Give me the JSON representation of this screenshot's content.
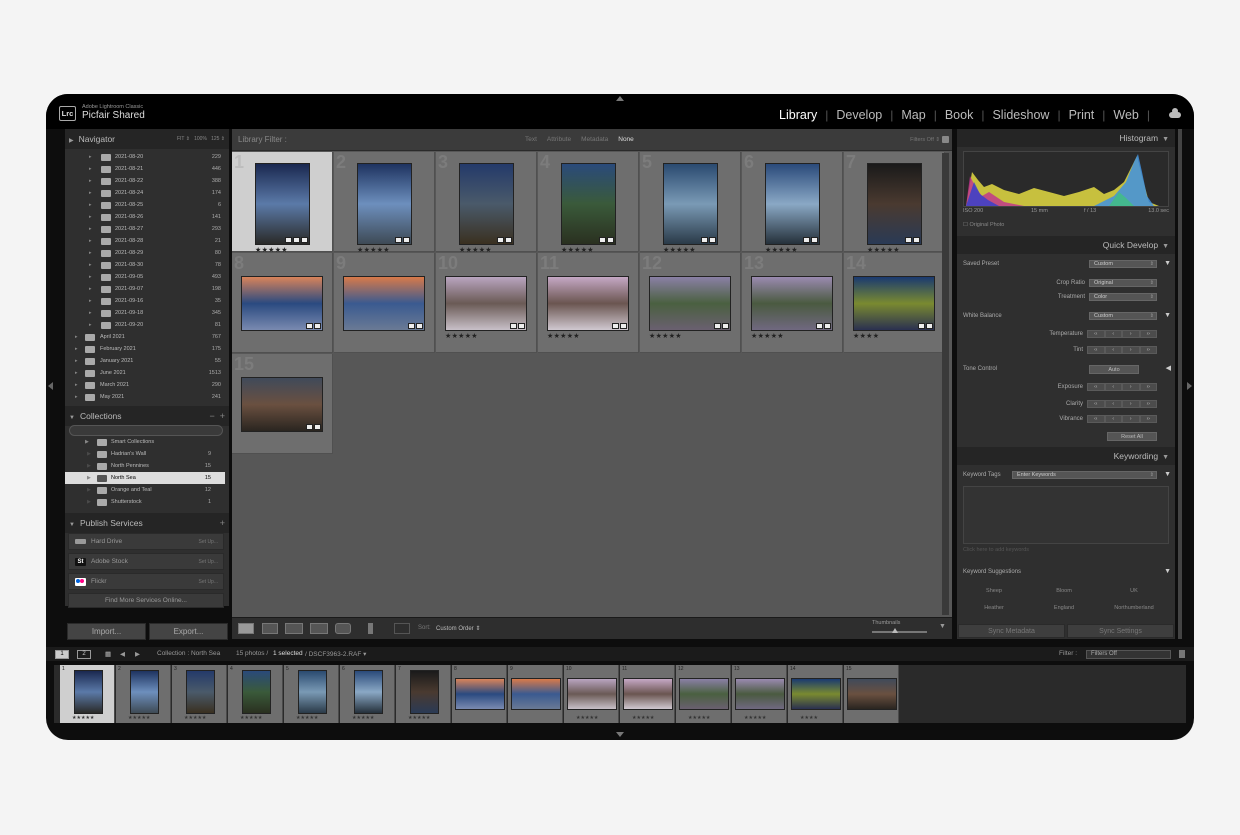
{
  "app": {
    "product": "Adobe Lightroom Classic",
    "catalog": "Picfair Shared",
    "logo": "Lrc",
    "modules": [
      "Library",
      "Develop",
      "Map",
      "Book",
      "Slideshow",
      "Print",
      "Web"
    ],
    "active_module": "Library"
  },
  "navigator": {
    "title": "Navigator",
    "zoom_options": [
      "FIT ⇕",
      "100%",
      "125 ⇕"
    ]
  },
  "folders": [
    {
      "name": "2021-08-20",
      "count": "229"
    },
    {
      "name": "2021-08-21",
      "count": "446"
    },
    {
      "name": "2021-08-22",
      "count": "388"
    },
    {
      "name": "2021-08-24",
      "count": "174"
    },
    {
      "name": "2021-08-25",
      "count": "6"
    },
    {
      "name": "2021-08-26",
      "count": "141"
    },
    {
      "name": "2021-08-27",
      "count": "293"
    },
    {
      "name": "2021-08-28",
      "count": "21"
    },
    {
      "name": "2021-08-29",
      "count": "80"
    },
    {
      "name": "2021-08-30",
      "count": "78"
    },
    {
      "name": "2021-09-05",
      "count": "493"
    },
    {
      "name": "2021-09-07",
      "count": "198"
    },
    {
      "name": "2021-09-16",
      "count": "35"
    },
    {
      "name": "2021-09-18",
      "count": "345"
    },
    {
      "name": "2021-09-20",
      "count": "81"
    },
    {
      "name": "April 2021",
      "count": "767"
    },
    {
      "name": "February 2021",
      "count": "175"
    },
    {
      "name": "January 2021",
      "count": "55"
    },
    {
      "name": "June 2021",
      "count": "1513"
    },
    {
      "name": "March 2021",
      "count": "290"
    },
    {
      "name": "May 2021",
      "count": "241"
    }
  ],
  "collections": {
    "title": "Collections",
    "items": [
      {
        "name": "Smart Collections",
        "count": ""
      },
      {
        "name": "Hadrian's Wall",
        "count": "9"
      },
      {
        "name": "North Pennines",
        "count": "15"
      },
      {
        "name": "North Sea",
        "count": "15"
      },
      {
        "name": "Orange and Teal",
        "count": "12"
      },
      {
        "name": "Shutterstock",
        "count": "1"
      }
    ]
  },
  "publish": {
    "title": "Publish Services",
    "services": [
      {
        "name": "Hard Drive",
        "setup": "Set Up..."
      },
      {
        "name": "Adobe Stock",
        "setup": "Set Up..."
      },
      {
        "name": "Flickr",
        "setup": "Set Up..."
      }
    ],
    "find_more": "Find More Services Online..."
  },
  "buttons": {
    "import": "Import...",
    "export": "Export..."
  },
  "library_filter": {
    "label": "Library Filter :",
    "tabs": [
      "Text",
      "Attribute",
      "Metadata",
      "None"
    ],
    "active": "None",
    "filters_off": "Filters Off ⇕"
  },
  "grid": {
    "cells": [
      {
        "num": "1",
        "stars": "★★★★★",
        "colors": [
          "#1a2850",
          "#5b7aa8",
          "#2a2a28"
        ]
      },
      {
        "num": "2",
        "stars": "★★★★★",
        "colors": [
          "#1e3360",
          "#6d8fbd",
          "#3e4a55"
        ]
      },
      {
        "num": "3",
        "stars": "★★★★★",
        "colors": [
          "#243a6a",
          "#4a5a6a",
          "#3a3020"
        ]
      },
      {
        "num": "4",
        "stars": "★★★★★",
        "colors": [
          "#2a4a7a",
          "#3a5a3a",
          "#2a3020"
        ]
      },
      {
        "num": "5",
        "stars": "★★★★★",
        "colors": [
          "#2a4a70",
          "#7a9ab5",
          "#2a3a48"
        ]
      },
      {
        "num": "6",
        "stars": "★★★★★",
        "colors": [
          "#2a4a7a",
          "#8aa8c5",
          "#25303a"
        ]
      },
      {
        "num": "7",
        "stars": "★★★★★",
        "colors": [
          "#1a1a1a",
          "#4a3a30",
          "#2a3a55"
        ]
      },
      {
        "num": "8",
        "stars": "",
        "colors": [
          "#d8835a",
          "#2a4a80",
          "#7a8ab0"
        ]
      },
      {
        "num": "9",
        "stars": "",
        "colors": [
          "#d87a4a",
          "#3a5a90",
          "#6a7a95"
        ]
      },
      {
        "num": "10",
        "stars": "★★★★★",
        "colors": [
          "#b9a5c0",
          "#6a5a55",
          "#c8c0c8"
        ]
      },
      {
        "num": "11",
        "stars": "★★★★★",
        "colors": [
          "#c5a8c5",
          "#6a5550",
          "#d0c8d0"
        ]
      },
      {
        "num": "12",
        "stars": "★★★★★",
        "colors": [
          "#8a80a5",
          "#4a6040",
          "#6a6070"
        ]
      },
      {
        "num": "13",
        "stars": "★★★★★",
        "colors": [
          "#9a8ab0",
          "#4a5a40",
          "#706880"
        ]
      },
      {
        "num": "14",
        "stars": "★★★★",
        "colors": [
          "#1a3a70",
          "#7a8a30",
          "#2a3050"
        ]
      },
      {
        "num": "15",
        "stars": "",
        "colors": [
          "#404a5a",
          "#6a5040",
          "#2a2520"
        ]
      }
    ]
  },
  "toolbar": {
    "sort_label": "Sort:",
    "sort_value": "Custom Order ⇕",
    "thumbnails_label": "Thumbnails"
  },
  "histogram": {
    "title": "Histogram",
    "iso": "ISO 200",
    "focal": "15 mm",
    "aperture": "f / 13",
    "shutter": "13.0 sec",
    "original_photo": "Original Photo"
  },
  "quick_develop": {
    "title": "Quick Develop",
    "saved_preset_label": "Saved Preset",
    "saved_preset_value": "Custom",
    "crop_ratio_label": "Crop Ratio",
    "crop_ratio_value": "Original",
    "treatment_label": "Treatment",
    "treatment_value": "Color",
    "white_balance_label": "White Balance",
    "white_balance_value": "Custom",
    "temperature_label": "Temperature",
    "tint_label": "Tint",
    "tone_control_label": "Tone Control",
    "auto_label": "Auto",
    "exposure_label": "Exposure",
    "clarity_label": "Clarity",
    "vibrance_label": "Vibrance",
    "reset_all": "Reset All"
  },
  "keywording": {
    "title": "Keywording",
    "keyword_tags_label": "Keyword Tags",
    "keyword_tags_value": "Enter Keywords",
    "click_here": "Click here to add keywords",
    "suggestions_label": "Keyword Suggestions",
    "suggestions": [
      "Sheep",
      "Bloom",
      "UK",
      "Heather",
      "England",
      "Northumberland"
    ]
  },
  "sync": {
    "metadata": "Sync Metadata",
    "settings": "Sync Settings"
  },
  "filmstrip_bar": {
    "page1": "1",
    "page2": "2",
    "source": "Collection : North Sea",
    "count_prefix": "15 photos /",
    "selected": "1 selected",
    "file": "/ DSCF3963-2.RAF ▾",
    "filter_label": "Filter :",
    "filter_value": "Filters Off"
  }
}
